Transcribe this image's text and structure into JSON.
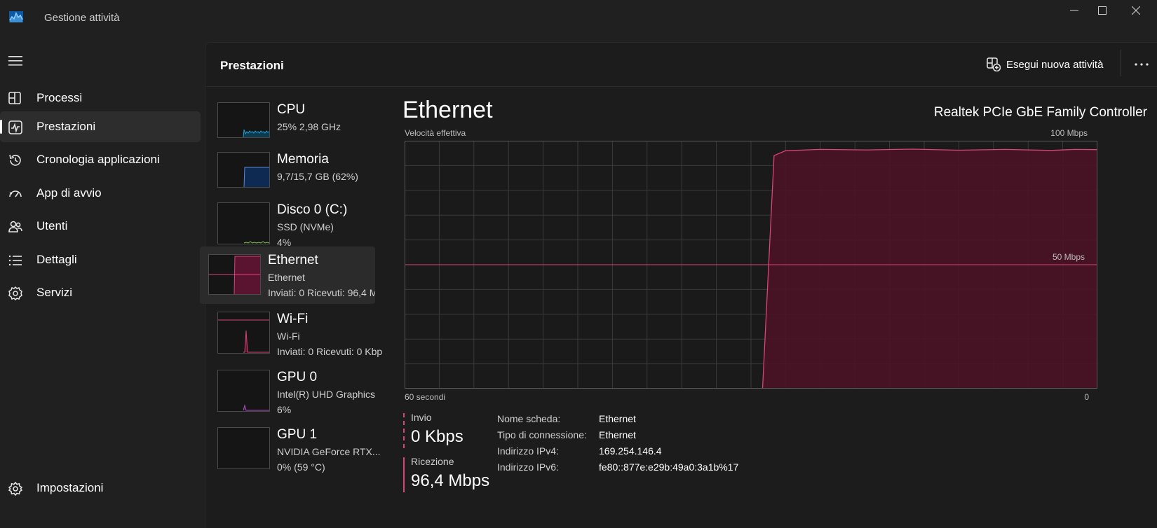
{
  "window": {
    "title": "Gestione attività"
  },
  "nav": {
    "items": [
      {
        "label": "Processi",
        "icon": "processes-icon"
      },
      {
        "label": "Prestazioni",
        "icon": "performance-icon",
        "active": true
      },
      {
        "label": "Cronologia applicazioni",
        "icon": "history-icon"
      },
      {
        "label": "App di avvio",
        "icon": "startup-icon"
      },
      {
        "label": "Utenti",
        "icon": "users-icon"
      },
      {
        "label": "Dettagli",
        "icon": "details-icon"
      },
      {
        "label": "Servizi",
        "icon": "services-icon"
      }
    ],
    "settings": {
      "label": "Impostazioni",
      "icon": "gear-icon"
    }
  },
  "header": {
    "title": "Prestazioni",
    "run_task_label": "Esegui nuova attività"
  },
  "perf_list": [
    {
      "name": "CPU",
      "line2": "25%  2,98 GHz",
      "line3": "",
      "color": "#1f9fd6"
    },
    {
      "name": "Memoria",
      "line2": "9,7/15,7 GB (62%)",
      "line3": "",
      "color": "#5b8ad8"
    },
    {
      "name": "Disco 0 (C:)",
      "line2": "SSD (NVMe)",
      "line3": "4%",
      "color": "#7ec24a"
    },
    {
      "name": "Ethernet",
      "line2": "Ethernet",
      "line3": "Inviati: 0 Ricevuti: 96,4 M",
      "color": "#d9457a",
      "active": true
    },
    {
      "name": "Wi-Fi",
      "line2": "Wi-Fi",
      "line3": "Inviati: 0 Ricevuti: 0 Kbp",
      "color": "#d9457a"
    },
    {
      "name": "GPU 0",
      "line2": "Intel(R) UHD Graphics",
      "line3": "6%",
      "color": "#b04ec8"
    },
    {
      "name": "GPU 1",
      "line2": "NVIDIA GeForce RTX...",
      "line3": "0%  (59 °C)",
      "color": "#b04ec8"
    }
  ],
  "detail": {
    "title": "Ethernet",
    "device": "Realtek PCIe GbE Family Controller",
    "graph_top_left": "Velocità effettiva",
    "graph_top_right": "100 Mbps",
    "graph_mid_right": "50 Mbps",
    "graph_bottom_left": "60 secondi",
    "graph_bottom_right": "0",
    "send_label": "Invio",
    "send_value": "0 Kbps",
    "recv_label": "Ricezione",
    "recv_value": "96,4 Mbps",
    "props": [
      {
        "key": "Nome scheda:",
        "value": "Ethernet"
      },
      {
        "key": "Tipo di connessione:",
        "value": "Ethernet"
      },
      {
        "key": "Indirizzo IPv4:",
        "value": "169.254.146.4"
      },
      {
        "key": "Indirizzo IPv6:",
        "value": "fe80::877e:e29b:49a0:3a1b%17"
      }
    ]
  },
  "colors": {
    "accent": "#d9457a",
    "graph_fill": "#4a1325",
    "grid": "#3a3a3a"
  },
  "chart_data": {
    "type": "area",
    "x_range": [
      60,
      0
    ],
    "ylim": [
      0,
      100
    ],
    "grid": true,
    "series": [
      {
        "name": "Ricezione",
        "x": [
          60,
          29,
          28,
          27,
          24,
          20,
          16,
          12,
          8,
          4,
          2,
          0
        ],
        "values": [
          0,
          0,
          94,
          96,
          96.5,
          96.3,
          96.6,
          96.2,
          96.5,
          96.1,
          96.5,
          96.4
        ]
      },
      {
        "name": "Invio",
        "x": [
          60,
          0
        ],
        "values": [
          50,
          50
        ]
      }
    ]
  }
}
